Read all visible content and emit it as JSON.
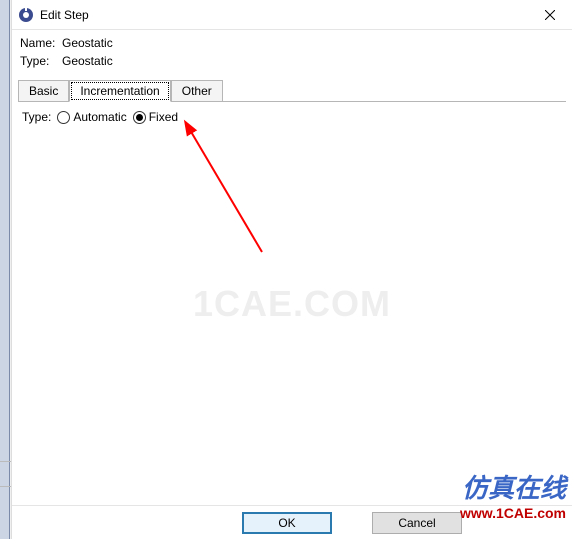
{
  "dialog": {
    "title": "Edit Step",
    "name_label": "Name:",
    "name_value": "Geostatic",
    "type_label": "Type:",
    "type_value": "Geostatic"
  },
  "tabs": {
    "basic": "Basic",
    "incrementation": "Incrementation",
    "other": "Other"
  },
  "panel": {
    "type_label": "Type:",
    "automatic_label": "Automatic",
    "fixed_label": "Fixed"
  },
  "buttons": {
    "ok": "OK",
    "cancel": "Cancel"
  },
  "watermark": "1CAE.COM",
  "brand": {
    "cn": "仿真在线",
    "url": "www.1CAE.com"
  }
}
